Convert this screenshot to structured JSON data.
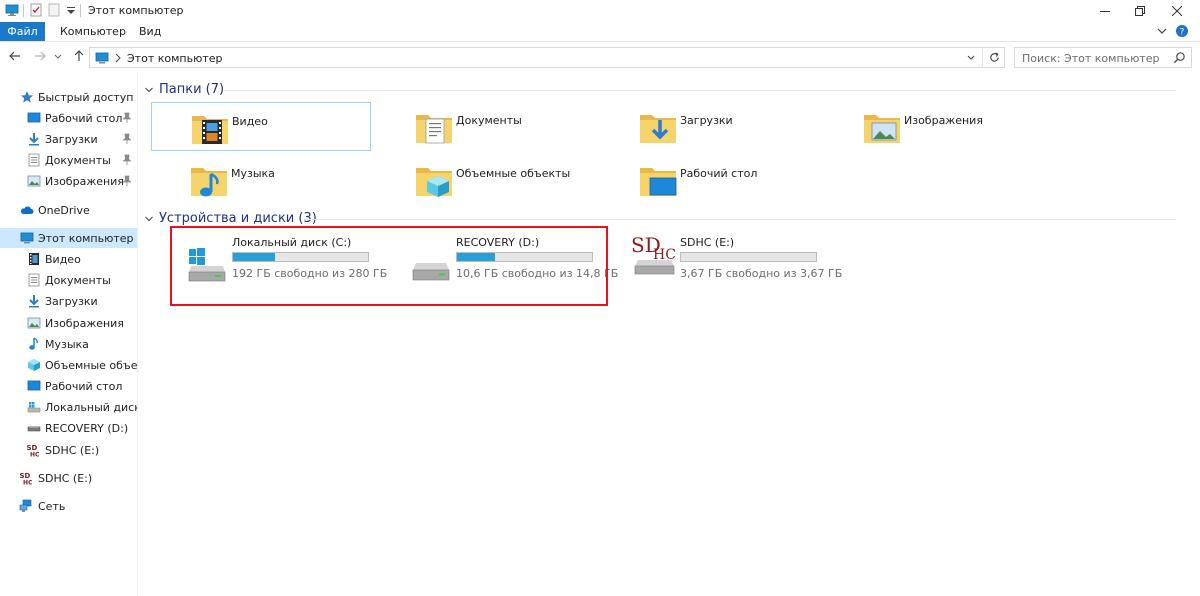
{
  "window": {
    "title": "Этот компьютер"
  },
  "ribbon": {
    "tabs": [
      {
        "label": "Файл",
        "active": true
      },
      {
        "label": "Компьютер",
        "active": false
      },
      {
        "label": "Вид",
        "active": false
      }
    ]
  },
  "address": {
    "path": "Этот компьютер",
    "search_placeholder": "Поиск: Этот компьютер"
  },
  "nav": {
    "items": [
      {
        "label": "Быстрый доступ",
        "icon": "star-icon",
        "pinned": false
      },
      {
        "label": "Рабочий стол",
        "icon": "desktop-icon",
        "pinned": true
      },
      {
        "label": "Загрузки",
        "icon": "download-icon",
        "pinned": true
      },
      {
        "label": "Документы",
        "icon": "documents-icon",
        "pinned": true
      },
      {
        "label": "Изображения",
        "icon": "pictures-icon",
        "pinned": true
      },
      {
        "label": "OneDrive",
        "icon": "cloud-icon",
        "pinned": false
      },
      {
        "label": "Этот компьютер",
        "icon": "computer-icon",
        "pinned": false
      },
      {
        "label": "Видео",
        "icon": "video-icon",
        "pinned": false
      },
      {
        "label": "Документы",
        "icon": "documents-icon",
        "pinned": false
      },
      {
        "label": "Загрузки",
        "icon": "download-icon",
        "pinned": false
      },
      {
        "label": "Изображения",
        "icon": "pictures-icon",
        "pinned": false
      },
      {
        "label": "Музыка",
        "icon": "music-icon",
        "pinned": false
      },
      {
        "label": "Объемные объекты",
        "icon": "3d-objects-icon",
        "pinned": false
      },
      {
        "label": "Рабочий стол",
        "icon": "desktop-icon",
        "pinned": false
      },
      {
        "label": "Локальный диск (C:)",
        "icon": "windows-drive-icon",
        "pinned": false
      },
      {
        "label": "RECOVERY (D:)",
        "icon": "drive-icon",
        "pinned": false
      },
      {
        "label": "SDHC (E:)",
        "icon": "sdhc-icon",
        "pinned": false
      },
      {
        "label": "SDHC (E:)",
        "icon": "sdhc-icon",
        "pinned": false
      },
      {
        "label": "Сеть",
        "icon": "network-icon",
        "pinned": false
      }
    ]
  },
  "folders_group": {
    "title": "Папки (7)",
    "items": [
      {
        "label": "Видео",
        "icon": "video-folder-icon"
      },
      {
        "label": "Документы",
        "icon": "documents-folder-icon"
      },
      {
        "label": "Загрузки",
        "icon": "downloads-folder-icon"
      },
      {
        "label": "Изображения",
        "icon": "pictures-folder-icon"
      },
      {
        "label": "Музыка",
        "icon": "music-folder-icon"
      },
      {
        "label": "Объемные объекты",
        "icon": "3d-objects-folder-icon"
      },
      {
        "label": "Рабочий стол",
        "icon": "desktop-folder-icon"
      }
    ]
  },
  "drives_group": {
    "title": "Устройства и диски (3)",
    "items": [
      {
        "name": "Локальный диск (C:)",
        "free_text": "192 ГБ свободно из 280 ГБ",
        "used_fraction": 0.314,
        "icon": "windows-drive-icon",
        "bar_color": "#26a0da"
      },
      {
        "name": "RECOVERY (D:)",
        "free_text": "10,6 ГБ свободно из 14,8 ГБ",
        "used_fraction": 0.284,
        "icon": "drive-icon",
        "bar_color": "#26a0da"
      },
      {
        "name": "SDHC (E:)",
        "free_text": "3,67 ГБ свободно из 3,67 ГБ",
        "used_fraction": 0.0,
        "icon": "sdhc-icon",
        "bar_color": "#26a0da"
      }
    ]
  },
  "colors": {
    "accent": "#1979ca",
    "highlight": "#e81123",
    "selection": "#cce8ff"
  }
}
